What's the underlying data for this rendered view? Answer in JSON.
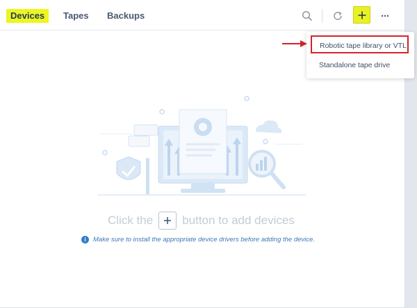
{
  "tabs": [
    {
      "label": "Devices",
      "active": true
    },
    {
      "label": "Tapes",
      "active": false
    },
    {
      "label": "Backups",
      "active": false
    }
  ],
  "toolbar": {
    "search_icon": "search-icon",
    "refresh_icon": "refresh-icon",
    "add_icon": "plus-icon",
    "more_label": "···"
  },
  "add_menu": {
    "items": [
      {
        "label": "Robotic tape library or VTL",
        "highlighted": true
      },
      {
        "label": "Standalone tape drive",
        "highlighted": false
      }
    ]
  },
  "empty_state": {
    "text_before": "Click the",
    "text_after": "button to add devices",
    "note": "Make sure to install the appropriate device drivers before adding the device."
  },
  "colors": {
    "accent_highlight": "#eef51f",
    "annotation_red": "#d2232a",
    "illustration_blue": "#c9ddf3"
  }
}
